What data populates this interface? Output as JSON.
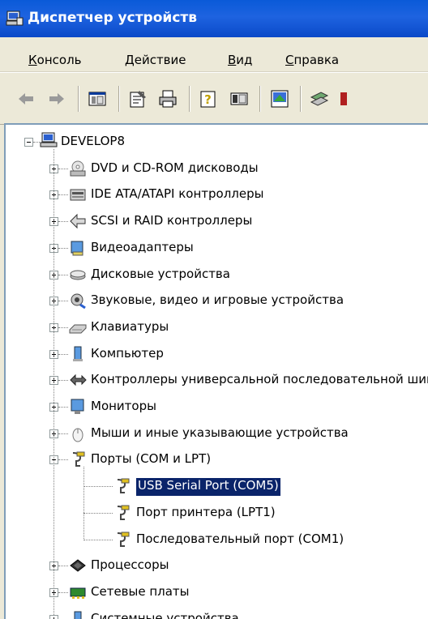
{
  "window": {
    "title": "Диспетчер устройств"
  },
  "menu": [
    {
      "label": "Консоль",
      "u": "К",
      "rest": "онсоль"
    },
    {
      "label": "Действие",
      "u": "Д",
      "rest": "ействие"
    },
    {
      "label": "Вид",
      "u": "В",
      "rest": "ид"
    },
    {
      "label": "Справка",
      "u": "С",
      "rest": "правка"
    }
  ],
  "tree": {
    "root": "DEVELOP8",
    "categories": [
      "DVD и CD-ROM дисководы",
      "IDE ATA/ATAPI контроллеры",
      "SCSI и RAID контроллеры",
      "Видеоадаптеры",
      "Дисковые устройства",
      "Звуковые, видео и игровые устройства",
      "Клавиатуры",
      "Компьютер",
      "Контроллеры универсальной последовательной шины USB",
      "Мониторы",
      "Мыши и иные указывающие устройства",
      "Порты (COM и LPT)",
      "Процессоры",
      "Сетевые платы",
      "Системные устройства"
    ],
    "ports": [
      "USB Serial Port (COM5)",
      "Порт принтера (LPT1)",
      "Последовательный порт (COM1)"
    ]
  },
  "colors": {
    "title_bar": "#0a5ad8",
    "selection": "#0a246a",
    "tree_border": "#7f9db9"
  }
}
